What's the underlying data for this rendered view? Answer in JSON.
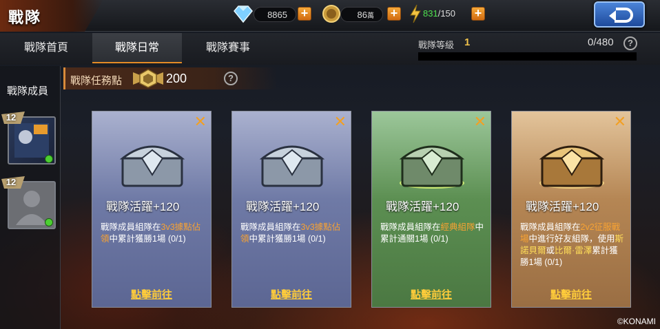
{
  "header": {
    "title": "戰隊",
    "diamonds": "8865",
    "coins": "86",
    "coins_unit": "萬",
    "energy_current": "831",
    "energy_max": "/150"
  },
  "tabs": [
    {
      "label": "戰隊首頁"
    },
    {
      "label": "戰隊日常"
    },
    {
      "label": "戰隊賽事"
    }
  ],
  "level": {
    "label": "戰隊等級",
    "value": "1",
    "xp": "0/480"
  },
  "sidebar": {
    "title": "戰隊成員",
    "members": [
      {
        "level": "12"
      },
      {
        "level": "12"
      }
    ]
  },
  "points": {
    "label": "戰隊任務點",
    "value": "200"
  },
  "cards": [
    {
      "activity": "戰隊活躍+120",
      "d1": "戰隊成員組隊在",
      "hl": "3v3據點佔領",
      "d2": "中累計獲勝1場 (0/1)",
      "action": "點擊前往"
    },
    {
      "activity": "戰隊活躍+120",
      "d1": "戰隊成員組隊在",
      "hl": "3v3據點佔領",
      "d2": "中累計獲勝1場 (0/1)",
      "action": "點擊前往"
    },
    {
      "activity": "戰隊活躍+120",
      "d1": "戰隊成員組隊在",
      "hl": "經典組隊",
      "d2": "中累計通關1場 (0/1)",
      "action": "點擊前往"
    },
    {
      "activity": "戰隊活躍+120",
      "d1": "戰隊成員組隊在",
      "hl": "2v2征服戰場",
      "d2": "中進行好友組隊，使用",
      "hl2": "斯諾貝爾",
      "d3": "或",
      "hl3": "比爾·雷澤",
      "d4": "累計獲勝1場 (0/1)",
      "action": "點擊前往"
    }
  ],
  "footer": {
    "copyright": "©KONAMI"
  },
  "colors": {
    "accent": "#e48b26",
    "highlight": "#f7a233",
    "go_link": "#ffcc3a"
  }
}
